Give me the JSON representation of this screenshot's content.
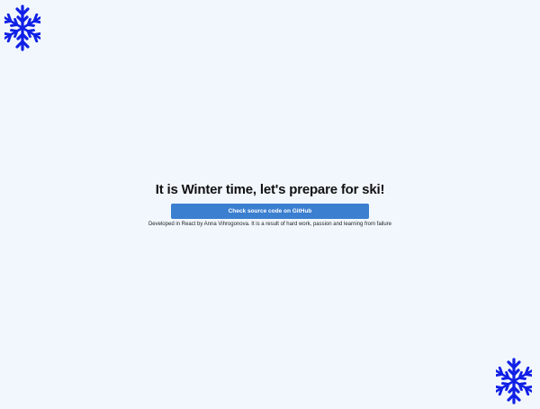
{
  "decorations": {
    "icon": "snowflake-icon",
    "color": "#1020e6"
  },
  "main": {
    "headline": "It is Winter time, let's prepare for ski!",
    "github_button_label": "Check source code on GitHub",
    "credit": "Developed in React by Anna Vihrogonova. It is a result of hard work, passion and learning from failure"
  },
  "colors": {
    "background": "#f1f7fd",
    "button": "#3a7fd0",
    "button_text": "#ffffff"
  }
}
